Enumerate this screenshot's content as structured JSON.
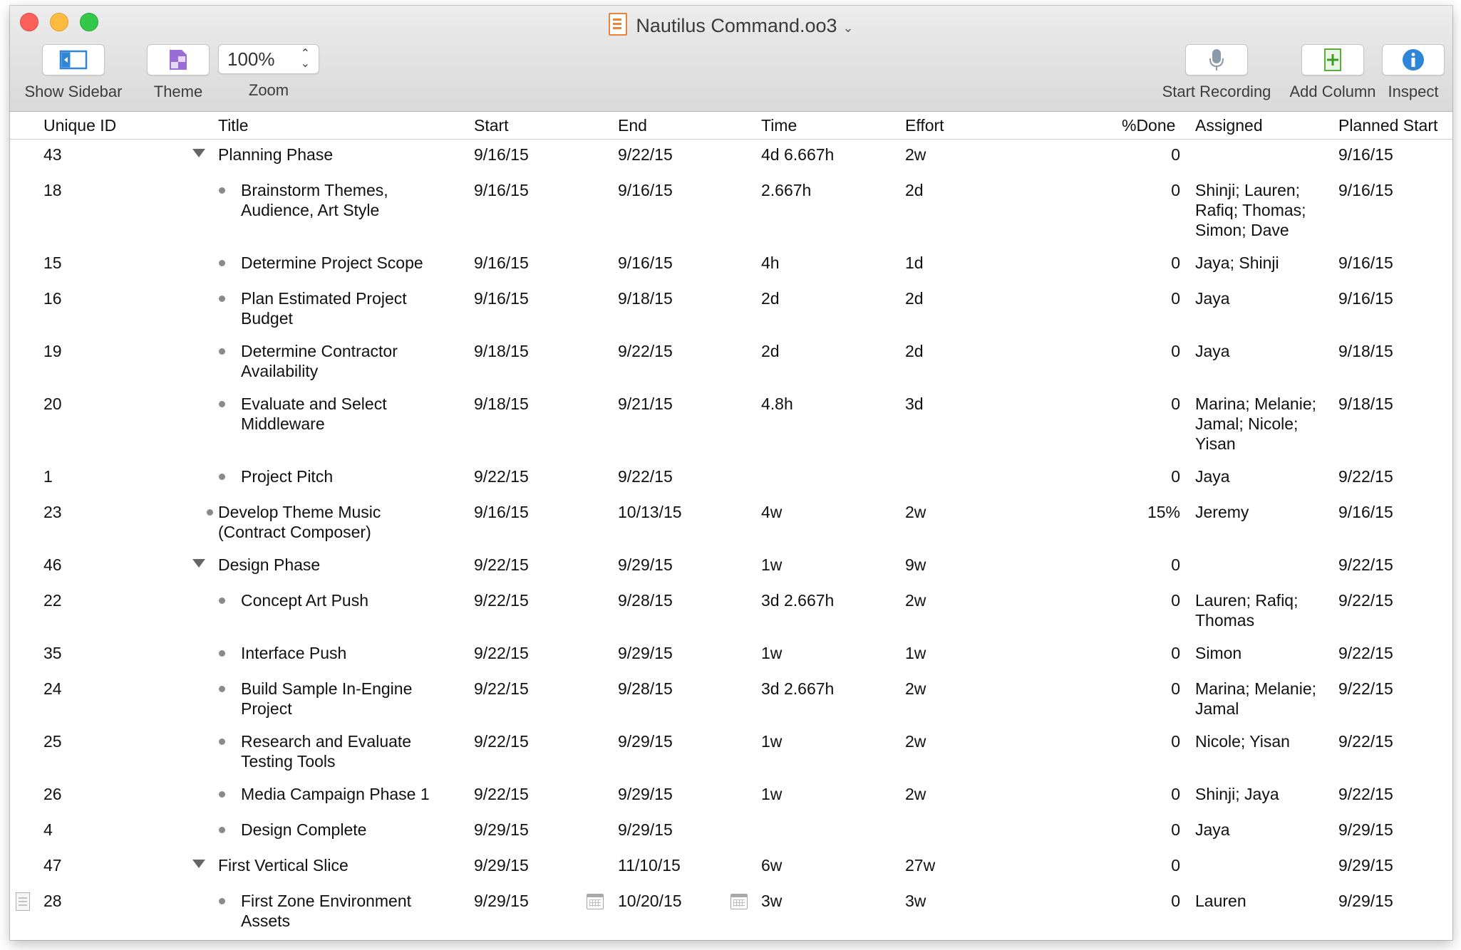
{
  "window": {
    "title": "Nautilus Command.oo3"
  },
  "toolbar": {
    "show_sidebar": "Show Sidebar",
    "theme": "Theme",
    "zoom_value": "100%",
    "zoom": "Zoom",
    "start_recording": "Start Recording",
    "add_column": "Add Column",
    "inspect": "Inspect"
  },
  "columns": {
    "unique_id": "Unique ID",
    "title": "Title",
    "start": "Start",
    "end": "End",
    "time": "Time",
    "effort": "Effort",
    "done": "%Done",
    "assigned": "Assigned",
    "planned_start": "Planned Start"
  },
  "rows": [
    {
      "id": "43",
      "title": "Planning Phase",
      "start": "9/16/15",
      "end": "9/22/15",
      "time": "4d 6.667h",
      "effort": "2w",
      "done": "0",
      "assigned": "",
      "planned_start": "9/16/15"
    },
    {
      "id": "18",
      "title": "Brainstorm Themes, Audience, Art Style",
      "start": "9/16/15",
      "end": "9/16/15",
      "time": "2.667h",
      "effort": "2d",
      "done": "0",
      "assigned": "Shinji; Lauren; Rafiq; Thomas; Simon; Dave",
      "planned_start": "9/16/15"
    },
    {
      "id": "15",
      "title": "Determine Project Scope",
      "start": "9/16/15",
      "end": "9/16/15",
      "time": "4h",
      "effort": "1d",
      "done": "0",
      "assigned": "Jaya; Shinji",
      "planned_start": "9/16/15"
    },
    {
      "id": "16",
      "title": "Plan Estimated Project Budget",
      "start": "9/16/15",
      "end": "9/18/15",
      "time": "2d",
      "effort": "2d",
      "done": "0",
      "assigned": "Jaya",
      "planned_start": "9/16/15"
    },
    {
      "id": "19",
      "title": "Determine Contractor Availability",
      "start": "9/18/15",
      "end": "9/22/15",
      "time": "2d",
      "effort": "2d",
      "done": "0",
      "assigned": "Jaya",
      "planned_start": "9/18/15"
    },
    {
      "id": "20",
      "title": "Evaluate and Select Middleware",
      "start": "9/18/15",
      "end": "9/21/15",
      "time": "4.8h",
      "effort": "3d",
      "done": "0",
      "assigned": "Marina; Melanie; Jamal; Nicole; Yisan",
      "planned_start": "9/18/15"
    },
    {
      "id": "1",
      "title": "Project Pitch",
      "start": "9/22/15",
      "end": "9/22/15",
      "time": "",
      "effort": "",
      "done": "0",
      "assigned": "Jaya",
      "planned_start": "9/22/15"
    },
    {
      "id": "23",
      "title": "Develop Theme Music (Contract Composer)",
      "start": "9/16/15",
      "end": "10/13/15",
      "time": "4w",
      "effort": "2w",
      "done": "15%",
      "assigned": "Jeremy",
      "planned_start": "9/16/15"
    },
    {
      "id": "46",
      "title": "Design Phase",
      "start": "9/22/15",
      "end": "9/29/15",
      "time": "1w",
      "effort": "9w",
      "done": "0",
      "assigned": "",
      "planned_start": "9/22/15"
    },
    {
      "id": "22",
      "title": "Concept Art Push",
      "start": "9/22/15",
      "end": "9/28/15",
      "time": "3d 2.667h",
      "effort": "2w",
      "done": "0",
      "assigned": "Lauren; Rafiq; Thomas",
      "planned_start": "9/22/15"
    },
    {
      "id": "35",
      "title": "Interface Push",
      "start": "9/22/15",
      "end": "9/29/15",
      "time": "1w",
      "effort": "1w",
      "done": "0",
      "assigned": "Simon",
      "planned_start": "9/22/15"
    },
    {
      "id": "24",
      "title": "Build Sample In-Engine Project",
      "start": "9/22/15",
      "end": "9/28/15",
      "time": "3d 2.667h",
      "effort": "2w",
      "done": "0",
      "assigned": "Marina; Melanie; Jamal",
      "planned_start": "9/22/15"
    },
    {
      "id": "25",
      "title": "Research and Evaluate Testing Tools",
      "start": "9/22/15",
      "end": "9/29/15",
      "time": "1w",
      "effort": "2w",
      "done": "0",
      "assigned": "Nicole; Yisan",
      "planned_start": "9/22/15"
    },
    {
      "id": "26",
      "title": "Media Campaign Phase 1",
      "start": "9/22/15",
      "end": "9/29/15",
      "time": "1w",
      "effort": "2w",
      "done": "0",
      "assigned": "Shinji; Jaya",
      "planned_start": "9/22/15"
    },
    {
      "id": "4",
      "title": "Design Complete",
      "start": "9/29/15",
      "end": "9/29/15",
      "time": "",
      "effort": "",
      "done": "0",
      "assigned": "Jaya",
      "planned_start": "9/29/15"
    },
    {
      "id": "47",
      "title": "First Vertical Slice",
      "start": "9/29/15",
      "end": "11/10/15",
      "time": "6w",
      "effort": "27w",
      "done": "0",
      "assigned": "",
      "planned_start": "9/29/15"
    },
    {
      "id": "28",
      "title": "First Zone Environment Assets",
      "start": "9/29/15",
      "end": "10/20/15",
      "time": "3w",
      "effort": "3w",
      "done": "0",
      "assigned": "Lauren",
      "planned_start": "9/29/15"
    }
  ]
}
